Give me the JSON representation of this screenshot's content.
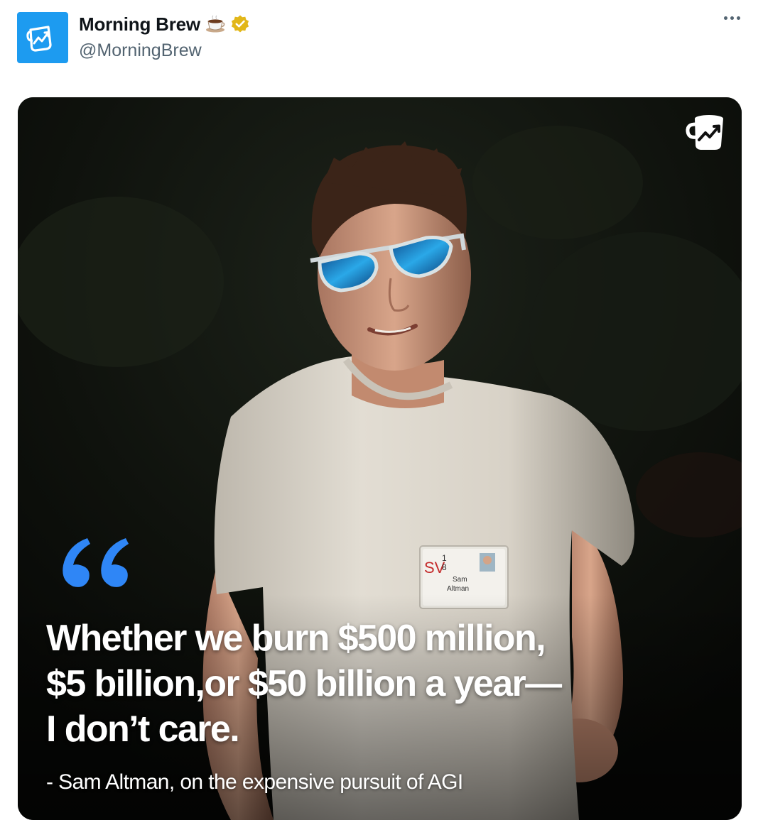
{
  "account": {
    "display_name": "Morning Brew",
    "handle": "@MorningBrew",
    "avatar_icon": "coffee-mug-chart-icon",
    "name_emoji": "coffee-cup-icon",
    "verified_badge": "verified-gold-icon"
  },
  "menu": {
    "icon": "more-options-icon"
  },
  "media": {
    "quote_lines": [
      "Whether we burn $500 million,",
      "$5 billion,or $50 billion a year—",
      "I don’t care."
    ],
    "attribution": "- Sam Altman, on the expensive pursuit of AGI",
    "badge": {
      "logo_sv": "SV",
      "logo_number_top": "1",
      "logo_number_bottom": "8",
      "first_name": "Sam",
      "last_name": "Altman"
    },
    "brand_icon": "coffee-mug-chart-icon",
    "quote_icon": "quotation-mark-icon"
  },
  "colors": {
    "accent": "#1d9bf0",
    "verified": "#e2b719",
    "handle": "#536471",
    "quote_mark": "#2f86f6"
  }
}
